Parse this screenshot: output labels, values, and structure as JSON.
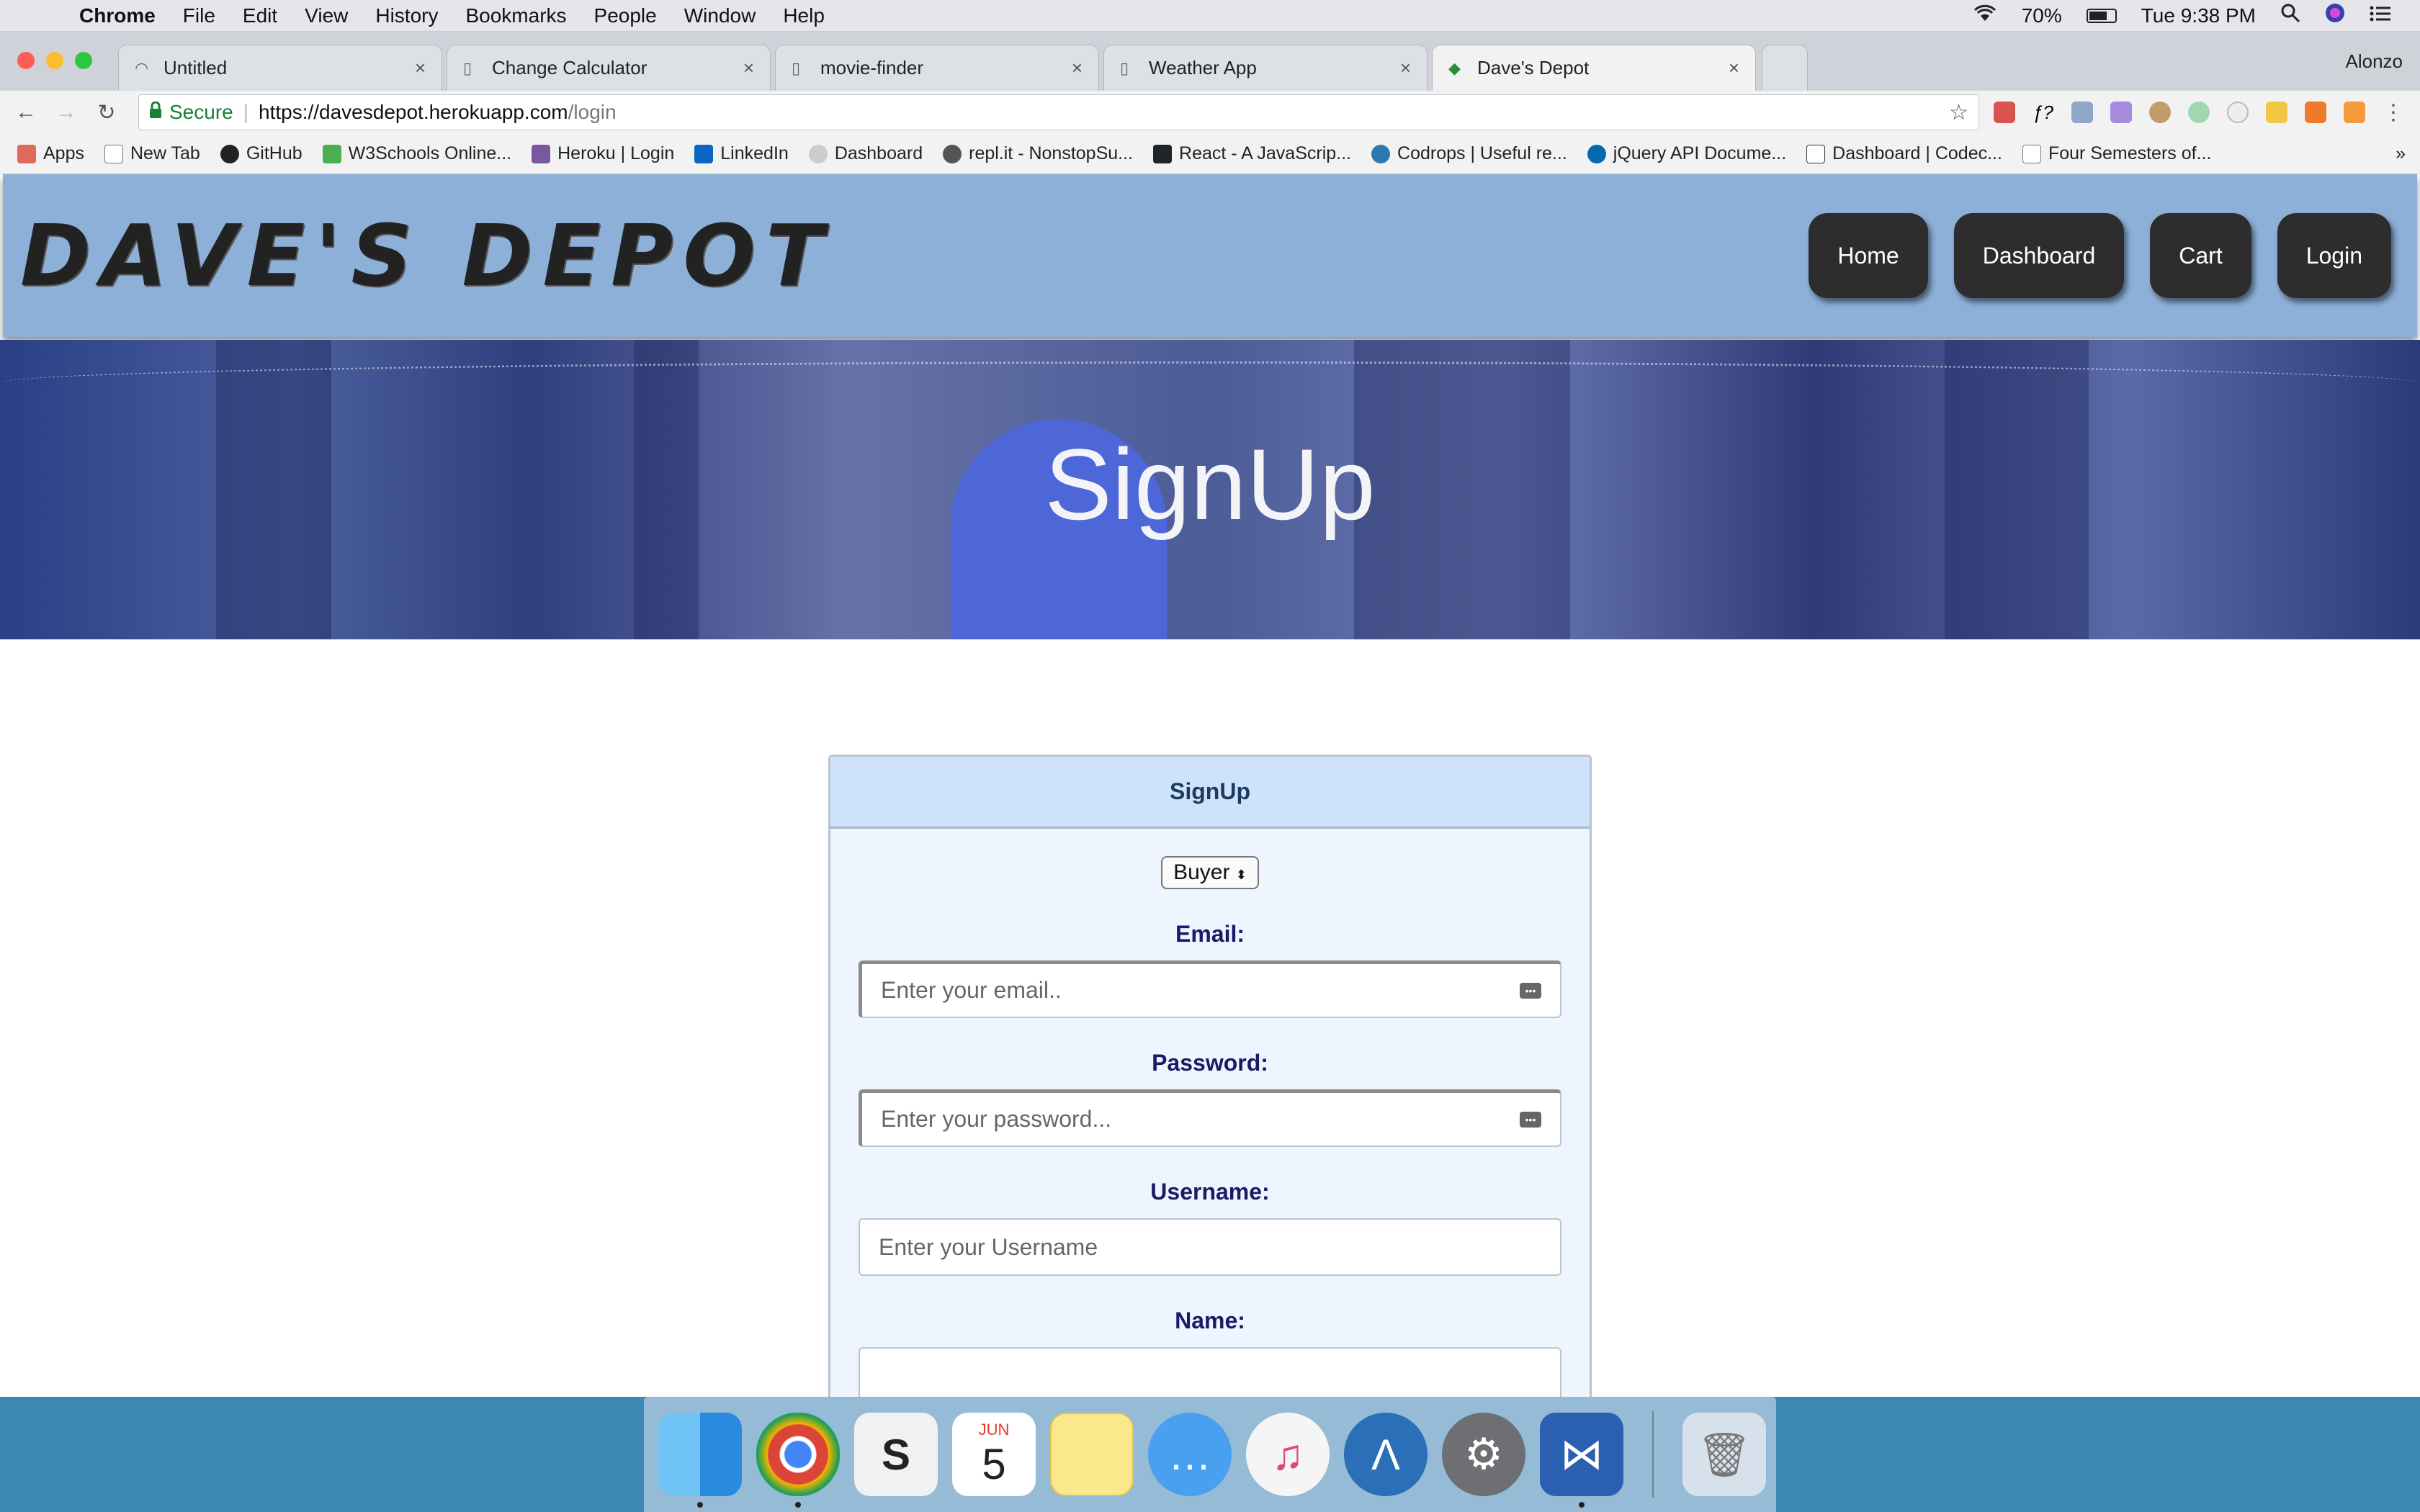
{
  "menubar": {
    "app": "Chrome",
    "items": [
      "File",
      "Edit",
      "View",
      "History",
      "Bookmarks",
      "People",
      "Window",
      "Help"
    ],
    "battery": "70%",
    "clock": "Tue 9:38 PM"
  },
  "tabs": [
    {
      "title": "Untitled"
    },
    {
      "title": "Change Calculator"
    },
    {
      "title": "movie-finder"
    },
    {
      "title": "Weather App"
    },
    {
      "title": "Dave's Depot"
    }
  ],
  "profile": "Alonzo",
  "address": {
    "secure_label": "Secure",
    "url_host": "https://davesdepot.herokuapp.com",
    "url_path": "/login"
  },
  "bookmarks": [
    "Apps",
    "New Tab",
    "GitHub",
    "W3Schools Online...",
    "Heroku | Login",
    "LinkedIn",
    "Dashboard",
    "repl.it - NonstopSu...",
    "React - A JavaScrip...",
    "Codrops | Useful re...",
    "jQuery API Docume...",
    "Dashboard | Codec...",
    "Four Semesters of..."
  ],
  "site": {
    "logo": "DAVE'S DEPOT",
    "nav": [
      "Home",
      "Dashboard",
      "Cart",
      "Login"
    ],
    "hero_title": "SignUp"
  },
  "form": {
    "title": "SignUp",
    "role": "Buyer",
    "email_label": "Email:",
    "email_placeholder": "Enter your email..",
    "password_label": "Password:",
    "password_placeholder": "Enter your password...",
    "username_label": "Username:",
    "username_placeholder": "Enter your Username",
    "name_label": "Name:"
  },
  "dock": {
    "calendar_month": "JUN",
    "calendar_day": "5"
  },
  "colors": {
    "header_bg": "#8db0d9",
    "nav_button": "#2d2d2d",
    "card_header": "#cfe2fb",
    "label_color": "#1a1a66"
  }
}
